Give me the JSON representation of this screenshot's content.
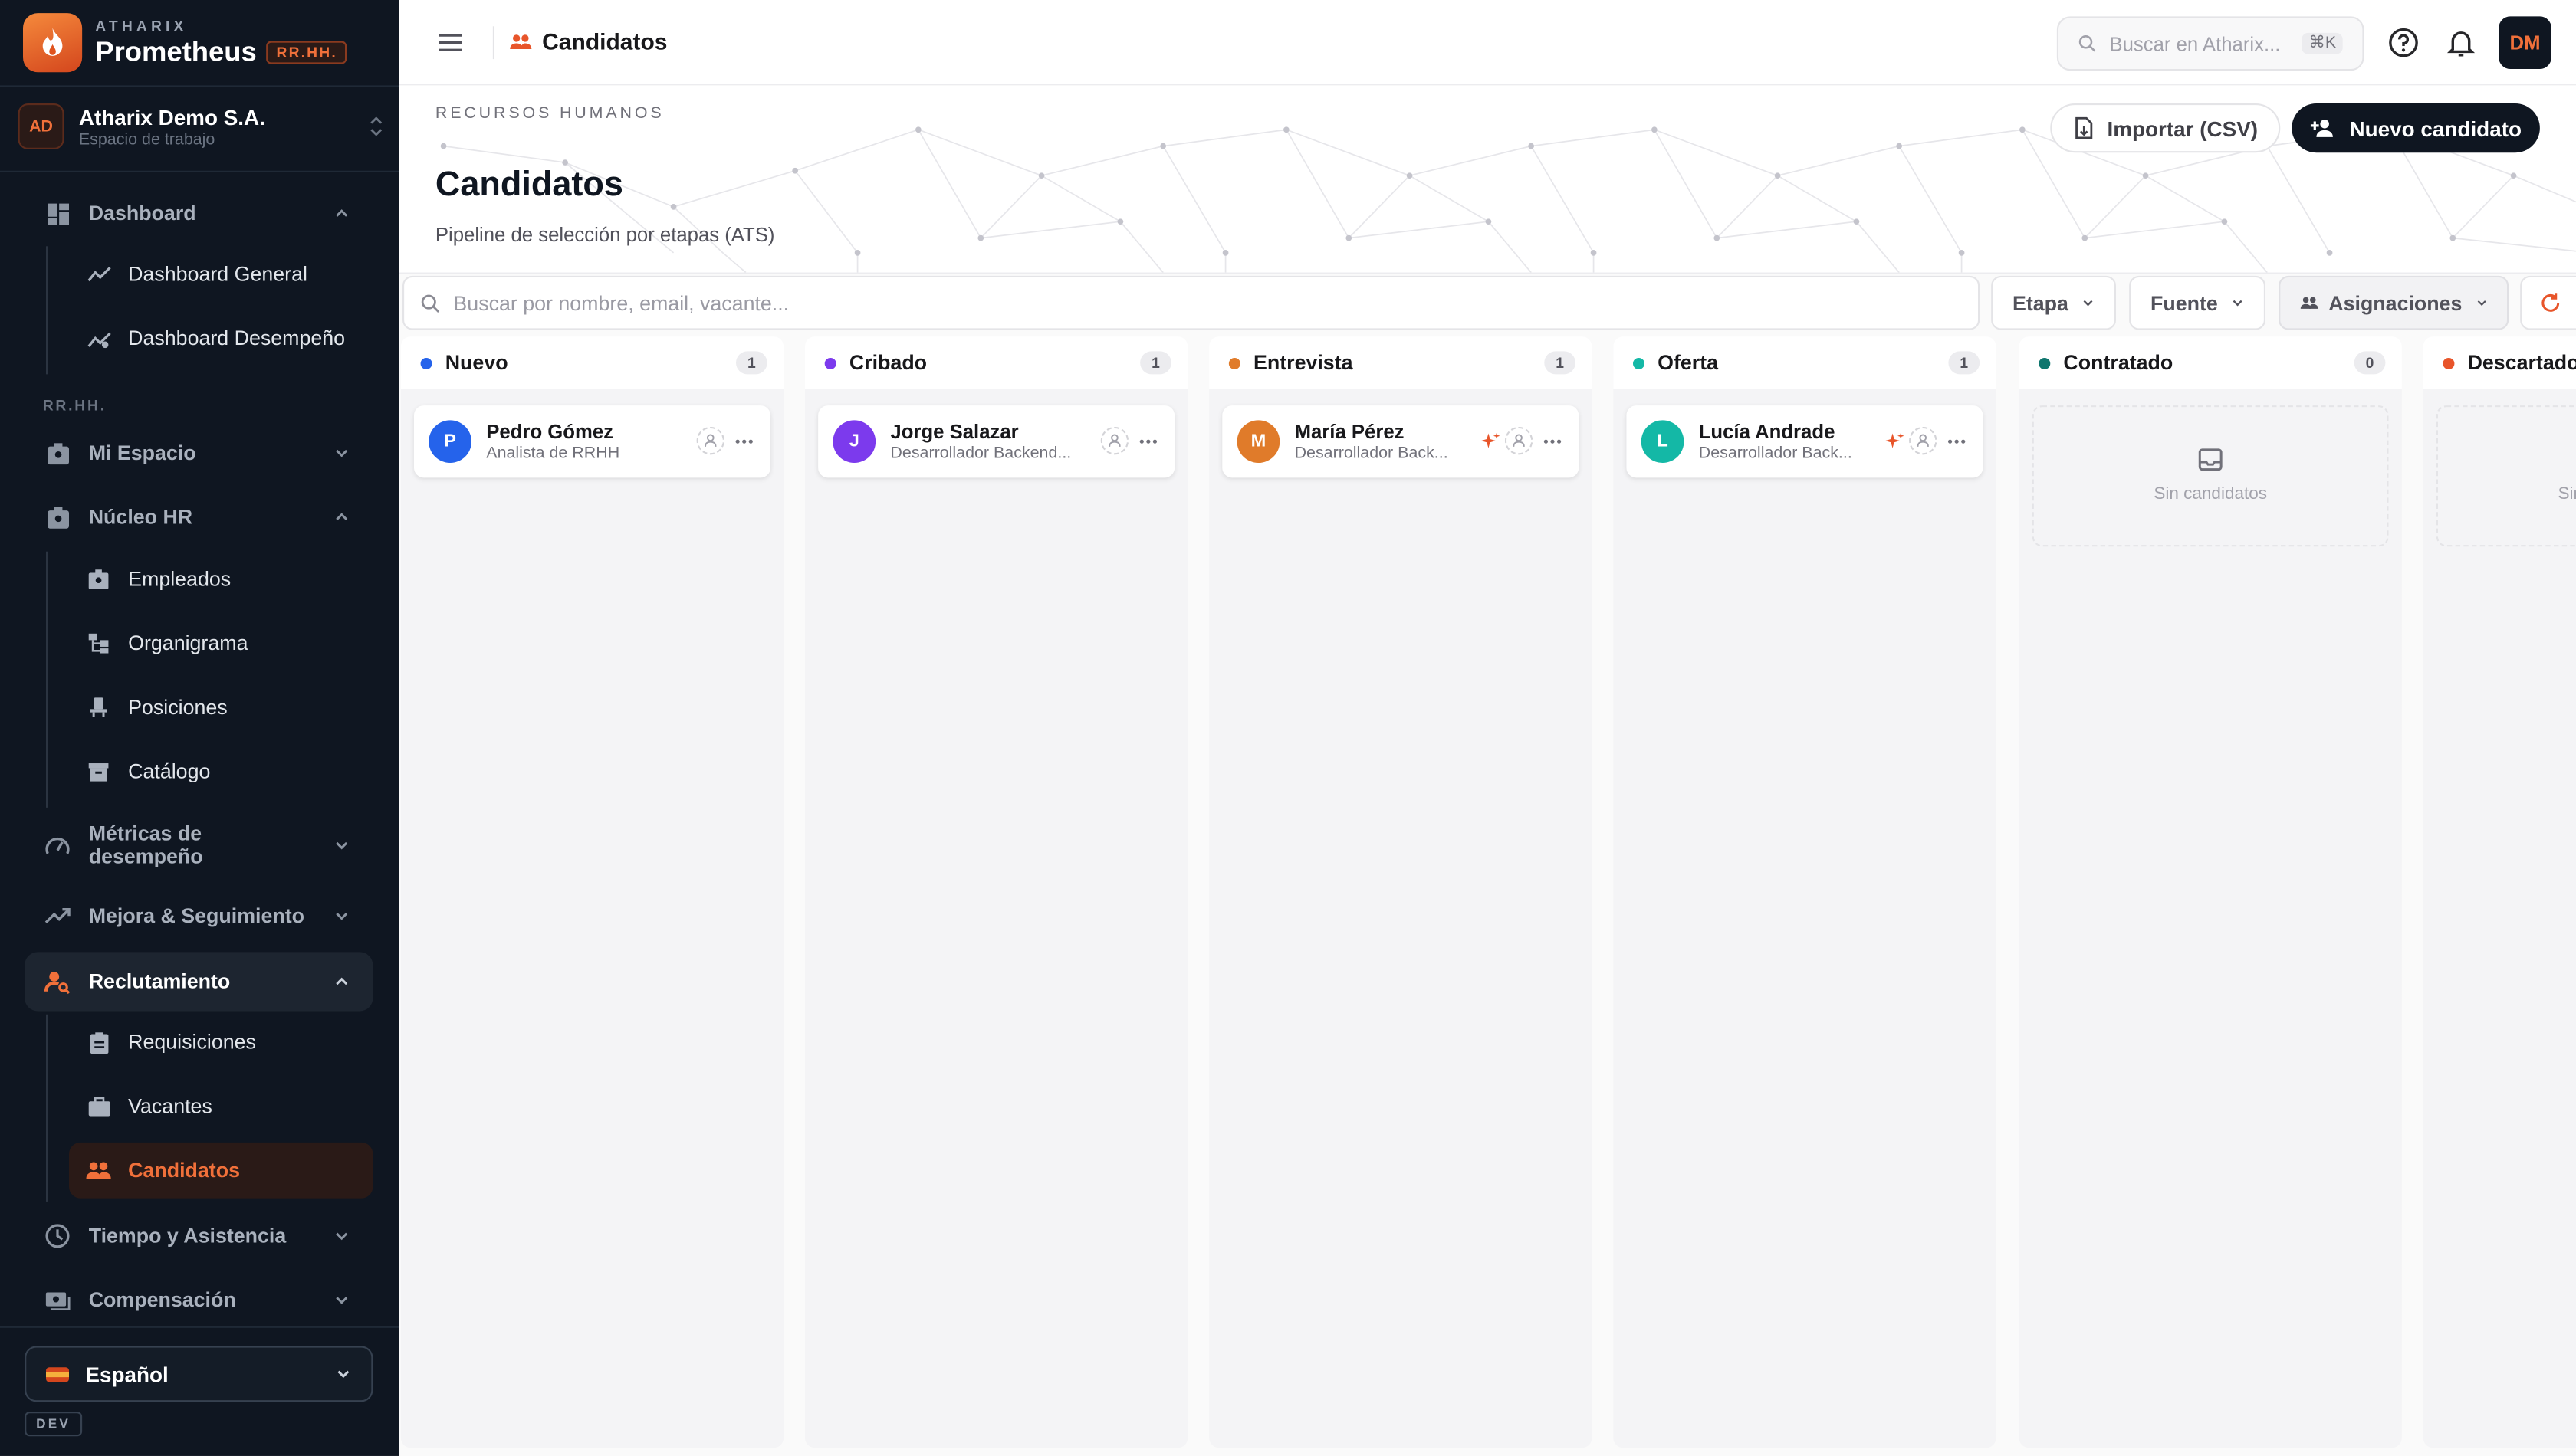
{
  "brand": {
    "kicker": "ATHARIX",
    "name": "Prometheus",
    "badge": "RR.HH."
  },
  "workspace": {
    "initials": "AD",
    "name": "Atharix Demo S.A.",
    "subtitle": "Espacio de trabajo"
  },
  "sidebar": {
    "dashboard": {
      "label": "Dashboard",
      "children": [
        "Dashboard General",
        "Dashboard Desempeño"
      ]
    },
    "group_label": "RR.HH.",
    "mi_espacio": "Mi Espacio",
    "nucleo": {
      "label": "Núcleo HR",
      "children": [
        "Empleados",
        "Organigrama",
        "Posiciones",
        "Catálogo"
      ]
    },
    "metricas": {
      "line1": "Métricas de",
      "line2": "desempeño"
    },
    "mejora": "Mejora & Seguimiento",
    "reclutamiento": {
      "label": "Reclutamiento",
      "children": [
        "Requisiciones",
        "Vacantes",
        "Candidatos"
      ]
    },
    "tiempo": "Tiempo y Asistencia",
    "compensacion": "Compensación",
    "language": "Español",
    "env": "DEV"
  },
  "topbar": {
    "breadcrumb": "Candidatos",
    "search_placeholder": "Buscar en Atharix...",
    "shortcut": "⌘K",
    "user_initials": "DM"
  },
  "header": {
    "kicker": "RECURSOS HUMANOS",
    "title": "Candidatos",
    "subtitle": "Pipeline de selección por etapas (ATS)",
    "import_label": "Importar (CSV)",
    "new_label": "Nuevo candidato"
  },
  "filters": {
    "search_placeholder": "Buscar por nombre, email, vacante...",
    "stage": "Etapa",
    "source": "Fuente",
    "assign": "Asignaciones"
  },
  "board": {
    "columns": [
      {
        "label": "Nuevo",
        "count": "1",
        "color": "#2563eb",
        "card": {
          "initial": "P",
          "name": "Pedro Gómez",
          "role": "Analista de RRHH",
          "avatar_color": "#2563eb"
        }
      },
      {
        "label": "Cribado",
        "count": "1",
        "color": "#7c3aed",
        "card": {
          "initial": "J",
          "name": "Jorge Salazar",
          "role": "Desarrollador Backend...",
          "avatar_color": "#7c3aed"
        }
      },
      {
        "label": "Entrevista",
        "count": "1",
        "color": "#e07b2a",
        "card": {
          "initial": "M",
          "name": "María Pérez",
          "role": "Desarrollador Back...",
          "avatar_color": "#e07b2a"
        }
      },
      {
        "label": "Oferta",
        "count": "1",
        "color": "#14b8a6",
        "card": {
          "initial": "L",
          "name": "Lucía Andrade",
          "role": "Desarrollador Back...",
          "avatar_color": "#14b8a6"
        }
      },
      {
        "label": "Contratado",
        "count": "0",
        "color": "#0f766e",
        "empty": "Sin candidatos"
      },
      {
        "label": "Descartado",
        "count": "",
        "color": "#e8552a",
        "empty": "Sin candidatos"
      }
    ]
  }
}
